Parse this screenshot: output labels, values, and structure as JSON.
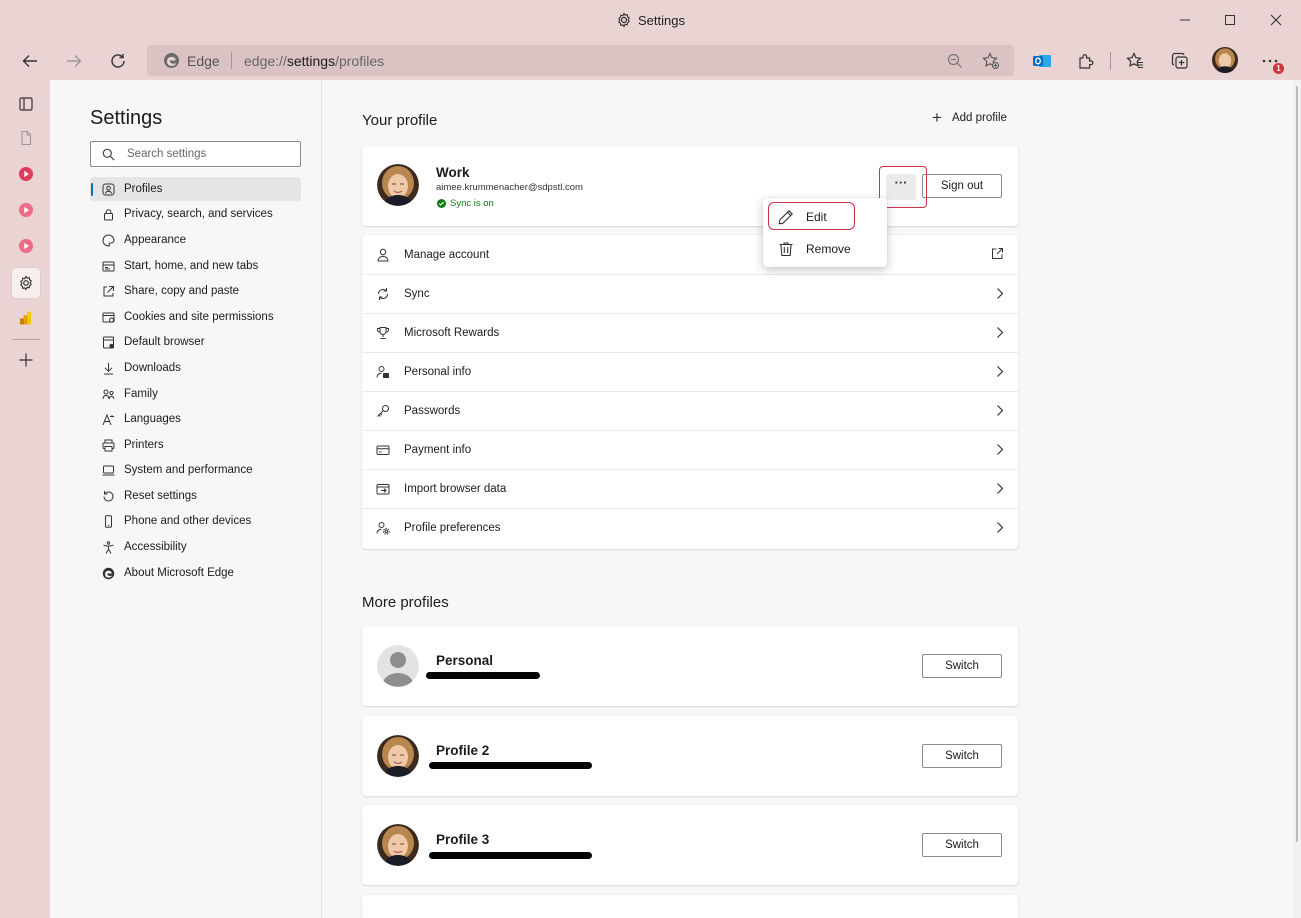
{
  "window": {
    "title": "Settings"
  },
  "toolbar": {
    "address_brand": "Edge",
    "url_prefix": "edge://",
    "url_host": "settings",
    "url_path": "/profiles",
    "notification_badge": "1"
  },
  "nav": {
    "title": "Settings",
    "search_placeholder": "Search settings",
    "items": [
      {
        "label": "Profiles",
        "icon": "profile-icon"
      },
      {
        "label": "Privacy, search, and services",
        "icon": "lock-icon"
      },
      {
        "label": "Appearance",
        "icon": "appearance-icon"
      },
      {
        "label": "Start, home, and new tabs",
        "icon": "home-tabs-icon"
      },
      {
        "label": "Share, copy and paste",
        "icon": "share-icon"
      },
      {
        "label": "Cookies and site permissions",
        "icon": "cookies-icon"
      },
      {
        "label": "Default browser",
        "icon": "default-browser-icon"
      },
      {
        "label": "Downloads",
        "icon": "download-icon"
      },
      {
        "label": "Family",
        "icon": "family-icon"
      },
      {
        "label": "Languages",
        "icon": "languages-icon"
      },
      {
        "label": "Printers",
        "icon": "printer-icon"
      },
      {
        "label": "System and performance",
        "icon": "system-icon"
      },
      {
        "label": "Reset settings",
        "icon": "reset-icon"
      },
      {
        "label": "Phone and other devices",
        "icon": "phone-icon"
      },
      {
        "label": "Accessibility",
        "icon": "accessibility-icon"
      },
      {
        "label": "About Microsoft Edge",
        "icon": "edge-icon"
      }
    ]
  },
  "main": {
    "your_profile_heading": "Your profile",
    "add_profile_label": "Add profile",
    "current_profile": {
      "name": "Work",
      "email": "aimee.krummenacher@sdpstl.com",
      "sync_status": "Sync is on",
      "more_label": "···",
      "sign_out_label": "Sign out"
    },
    "menu": {
      "edit_label": "Edit",
      "remove_label": "Remove"
    },
    "settings_rows": [
      {
        "label": "Manage account",
        "icon": "person-icon",
        "trailing": "external-link-icon"
      },
      {
        "label": "Sync",
        "icon": "sync-icon",
        "trailing": "chevron-right-icon"
      },
      {
        "label": "Microsoft Rewards",
        "icon": "trophy-icon",
        "trailing": "chevron-right-icon"
      },
      {
        "label": "Personal info",
        "icon": "person-card-icon",
        "trailing": "chevron-right-icon"
      },
      {
        "label": "Passwords",
        "icon": "key-icon",
        "trailing": "chevron-right-icon"
      },
      {
        "label": "Payment info",
        "icon": "card-icon",
        "trailing": "chevron-right-icon"
      },
      {
        "label": "Import browser data",
        "icon": "import-icon",
        "trailing": "chevron-right-icon"
      },
      {
        "label": "Profile preferences",
        "icon": "profile-settings-icon",
        "trailing": "chevron-right-icon"
      }
    ],
    "more_profiles_heading": "More profiles",
    "other_profiles": [
      {
        "name": "Personal",
        "switch_label": "Switch"
      },
      {
        "name": "Profile 2",
        "switch_label": "Switch"
      },
      {
        "name": "Profile 3",
        "switch_label": "Switch"
      }
    ]
  },
  "colors": {
    "accent": "#0f6cbd",
    "highlight": "#cc3344",
    "chrome": "#e9d3d3",
    "sync_green": "#107c10"
  }
}
